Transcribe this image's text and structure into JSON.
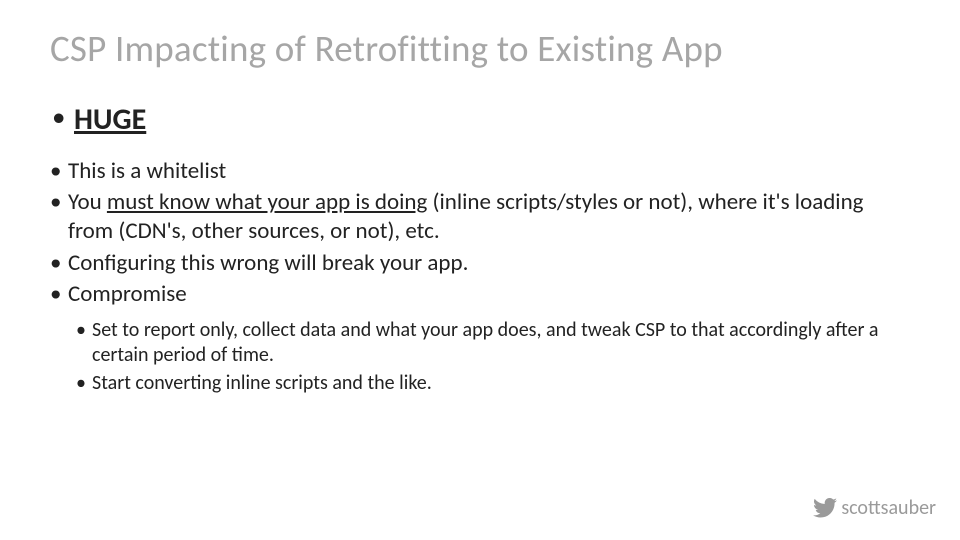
{
  "title": "CSP Impacting of Retrofitting to Existing App",
  "bullets": {
    "huge": "HUGE",
    "whitelist": "This is a whitelist",
    "mustknow_pre": "You ",
    "mustknow_u": "must know what your app is doing",
    "mustknow_post": " (inline scripts/styles or not), where it's loading from (CDN's, other sources, or not), etc.",
    "configure": "Configuring this wrong will break your app.",
    "compromise": "Compromise",
    "sub1": "Set to report only, collect data and what your app does, and tweak CSP to that accordingly after a certain period of time.",
    "sub2": "Start converting inline scripts and the like."
  },
  "footer": {
    "handle": "scottsauber"
  }
}
